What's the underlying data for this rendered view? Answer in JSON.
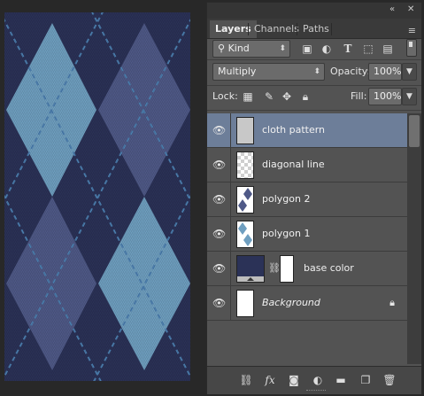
{
  "panel": {
    "tabs": [
      {
        "label": "Layers",
        "active": true
      },
      {
        "label": "Channels",
        "active": false
      },
      {
        "label": "Paths",
        "active": false
      }
    ],
    "top_icons": {
      "collapse": "«",
      "close": "✕"
    },
    "menu_icon": "≡",
    "filter": {
      "value": "Kind",
      "icon": "⚲"
    },
    "filter_icons": [
      "image-filter-icon",
      "adjustment-filter-icon",
      "type-filter-icon",
      "shape-filter-icon",
      "smart-object-filter-icon"
    ],
    "blend_mode": "Multiply",
    "opacity_label": "Opacity:",
    "opacity_value": "100%",
    "lock_label": "Lock:",
    "fill_label": "Fill:",
    "fill_value": "100%"
  },
  "layers": [
    {
      "name": "cloth pattern",
      "selected": true,
      "visible": true,
      "thumb": "gray"
    },
    {
      "name": "diagonal line",
      "selected": false,
      "visible": true,
      "thumb": "checker"
    },
    {
      "name": "polygon 2",
      "selected": false,
      "visible": true,
      "thumb": "diamond-dark"
    },
    {
      "name": "polygon 1",
      "selected": false,
      "visible": true,
      "thumb": "diamond-light"
    },
    {
      "name": "base color",
      "selected": false,
      "visible": true,
      "thumb": "solid-fill"
    },
    {
      "name": "Background",
      "selected": false,
      "visible": true,
      "thumb": "white",
      "locked": true
    }
  ],
  "bottom_icons": [
    "link-layers-icon",
    "fx-icon",
    "add-mask-icon",
    "adjustment-layer-icon",
    "new-group-icon",
    "new-layer-icon",
    "delete-layer-icon"
  ],
  "colors": {
    "canvas_base": "#2b3257",
    "diamond_light": "#6f9fc0",
    "diamond_dark": "#4f5987",
    "stitch": "#4c7fb0",
    "selected_row": "#6d7e99"
  }
}
